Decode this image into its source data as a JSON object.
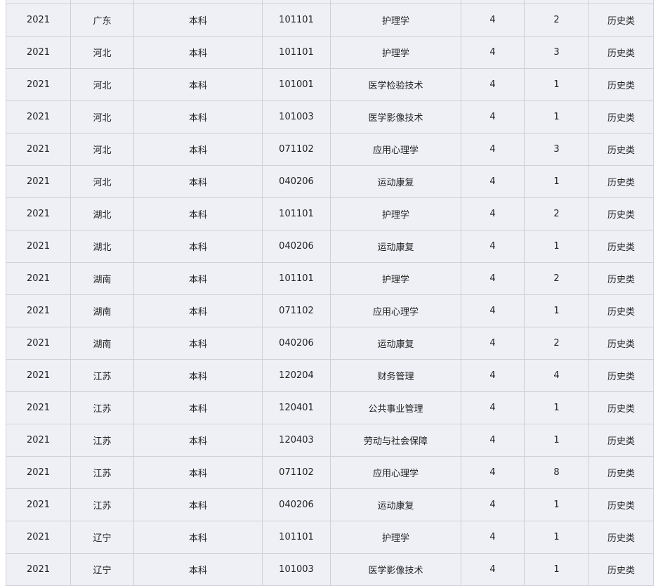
{
  "table": {
    "rows": [
      [
        "",
        "",
        "",
        "",
        "",
        "",
        "",
        ""
      ],
      [
        "2021",
        "广东",
        "本科",
        "101101",
        "护理学",
        "4",
        "2",
        "历史类"
      ],
      [
        "2021",
        "河北",
        "本科",
        "101101",
        "护理学",
        "4",
        "3",
        "历史类"
      ],
      [
        "2021",
        "河北",
        "本科",
        "101001",
        "医学检验技术",
        "4",
        "1",
        "历史类"
      ],
      [
        "2021",
        "河北",
        "本科",
        "101003",
        "医学影像技术",
        "4",
        "1",
        "历史类"
      ],
      [
        "2021",
        "河北",
        "本科",
        "071102",
        "应用心理学",
        "4",
        "3",
        "历史类"
      ],
      [
        "2021",
        "河北",
        "本科",
        "040206",
        "运动康复",
        "4",
        "1",
        "历史类"
      ],
      [
        "2021",
        "湖北",
        "本科",
        "101101",
        "护理学",
        "4",
        "2",
        "历史类"
      ],
      [
        "2021",
        "湖北",
        "本科",
        "040206",
        "运动康复",
        "4",
        "1",
        "历史类"
      ],
      [
        "2021",
        "湖南",
        "本科",
        "101101",
        "护理学",
        "4",
        "2",
        "历史类"
      ],
      [
        "2021",
        "湖南",
        "本科",
        "071102",
        "应用心理学",
        "4",
        "1",
        "历史类"
      ],
      [
        "2021",
        "湖南",
        "本科",
        "040206",
        "运动康复",
        "4",
        "2",
        "历史类"
      ],
      [
        "2021",
        "江苏",
        "本科",
        "120204",
        "财务管理",
        "4",
        "4",
        "历史类"
      ],
      [
        "2021",
        "江苏",
        "本科",
        "120401",
        "公共事业管理",
        "4",
        "1",
        "历史类"
      ],
      [
        "2021",
        "江苏",
        "本科",
        "120403",
        "劳动与社会保障",
        "4",
        "1",
        "历史类"
      ],
      [
        "2021",
        "江苏",
        "本科",
        "071102",
        "应用心理学",
        "4",
        "8",
        "历史类"
      ],
      [
        "2021",
        "江苏",
        "本科",
        "040206",
        "运动康复",
        "4",
        "1",
        "历史类"
      ],
      [
        "2021",
        "辽宁",
        "本科",
        "101101",
        "护理学",
        "4",
        "1",
        "历史类"
      ],
      [
        "2021",
        "辽宁",
        "本科",
        "101003",
        "医学影像技术",
        "4",
        "1",
        "历史类"
      ]
    ]
  }
}
